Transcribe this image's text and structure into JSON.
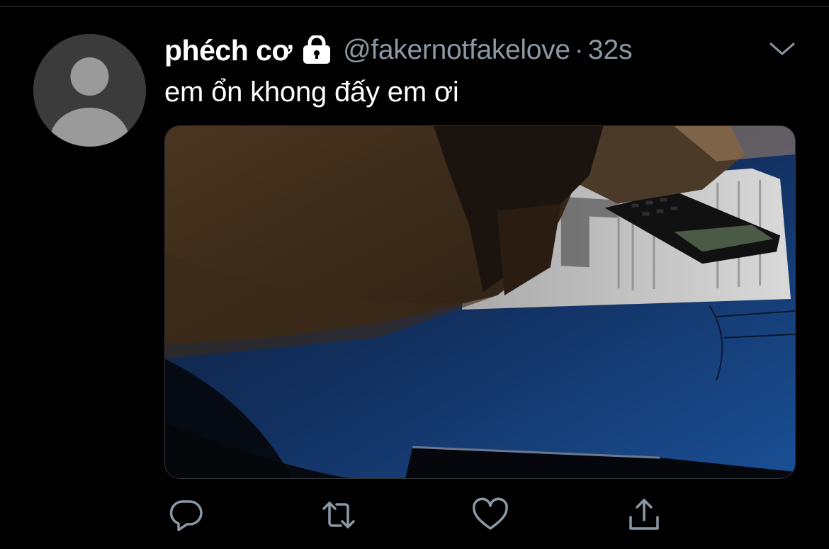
{
  "tweet": {
    "display_name": "phéch cơ",
    "handle": "@fakernotfakelove",
    "separator": "·",
    "time": "32s",
    "text": "em ổn khong đấy em ơi",
    "protected": true
  },
  "icons": {
    "avatar": "default-avatar-icon",
    "lock": "lock-icon",
    "more": "chevron-down-icon",
    "reply": "reply-icon",
    "retweet": "retweet-icon",
    "like": "heart-icon",
    "share": "share-icon"
  },
  "colors": {
    "background": "#000000",
    "secondary_text": "#8b98a5",
    "icon": "#8b98a5",
    "divider": "#2f3336"
  }
}
